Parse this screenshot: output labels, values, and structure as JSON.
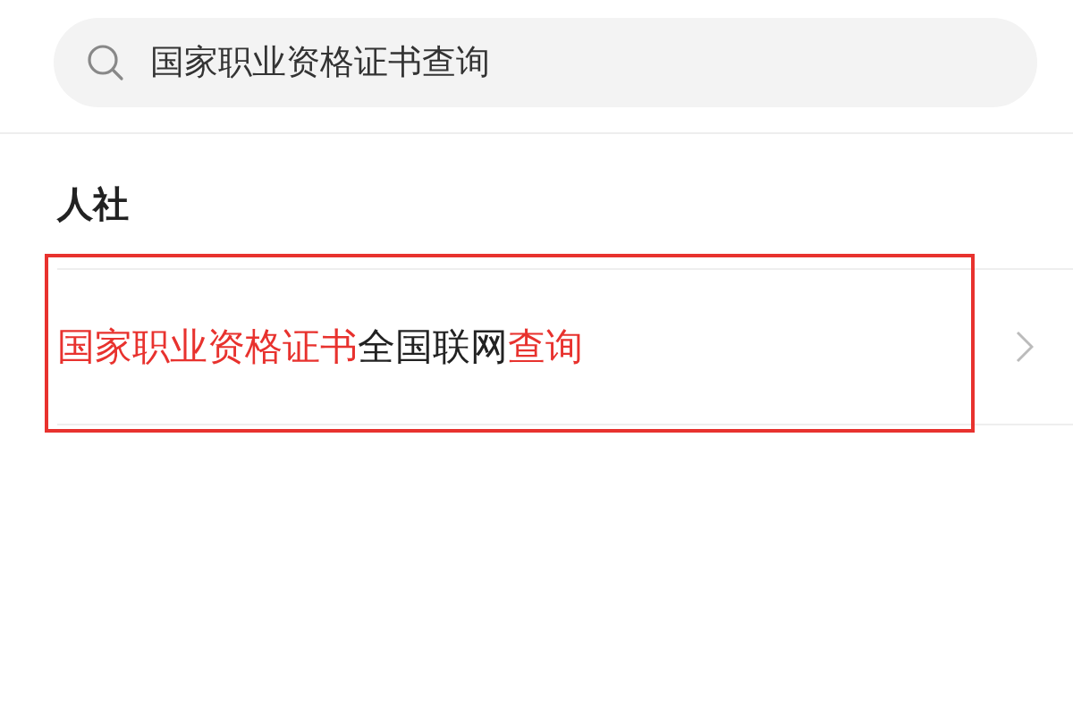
{
  "search": {
    "value": "国家职业资格证书查询"
  },
  "section": {
    "title": "人社"
  },
  "results": [
    {
      "segments": [
        {
          "text": "国家职业资格证书",
          "highlight": true
        },
        {
          "text": "全国联网",
          "highlight": false
        },
        {
          "text": "查询",
          "highlight": true
        }
      ],
      "marked": true
    }
  ]
}
